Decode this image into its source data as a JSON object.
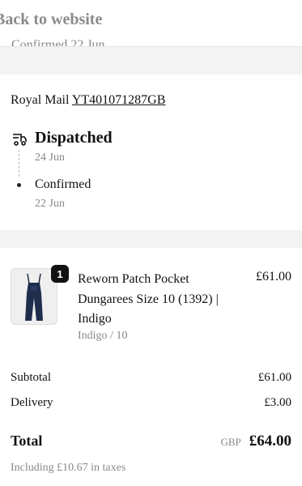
{
  "nav": {
    "back_label": "Back to website"
  },
  "history_cut": {
    "text": "Confirmed 22 Jun"
  },
  "shipment": {
    "carrier": "Royal Mail",
    "tracking_number": "YT401071287GB",
    "icon": "dispatch-truck-icon",
    "events": [
      {
        "status": "Dispatched",
        "date": "24 Jun"
      },
      {
        "status": "Confirmed",
        "date": "22 Jun"
      }
    ]
  },
  "order": {
    "item": {
      "quantity": "1",
      "name": "Reworn Patch Pocket Dungarees Size 10 (1392) | Indigo",
      "variant": "Indigo / 10",
      "price": "£61.00",
      "image": "dungarees-image"
    },
    "subtotal_label": "Subtotal",
    "subtotal": "£61.00",
    "delivery_label": "Delivery",
    "delivery": "£3.00",
    "total_label": "Total",
    "currency": "GBP",
    "total": "£64.00",
    "taxes_note": "Including £10.67 in taxes"
  }
}
